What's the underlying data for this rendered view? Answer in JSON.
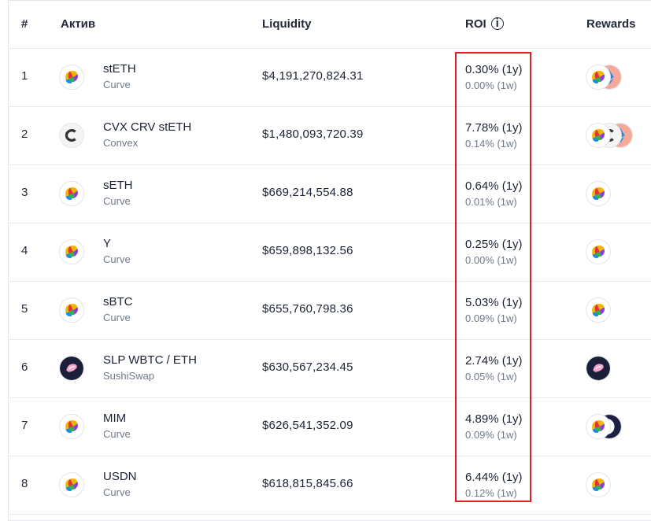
{
  "header": {
    "num": "#",
    "asset": "Актив",
    "liquidity": "Liquidity",
    "roi": "ROI",
    "roi_info_icon": "i",
    "rewards": "Rewards"
  },
  "colors": {
    "highlight": "#e11f1f",
    "muted": "#6f7a8a",
    "text": "#1a2233"
  },
  "rows": [
    {
      "num": "1",
      "name": "stETH",
      "protocol": "Curve",
      "liquidity": "$4,191,270,824.31",
      "roi_1y": "0.30% (1y)",
      "roi_1w": "0.00% (1w)",
      "icon": "curve-icon",
      "rewards": [
        "curve-icon",
        "lido-icon"
      ]
    },
    {
      "num": "2",
      "name": "CVX CRV stETH",
      "protocol": "Convex",
      "liquidity": "$1,480,093,720.39",
      "roi_1y": "7.78% (1y)",
      "roi_1w": "0.14% (1w)",
      "icon": "convex-icon",
      "rewards": [
        "curve-icon",
        "convex-icon",
        "lido-icon"
      ]
    },
    {
      "num": "3",
      "name": "sETH",
      "protocol": "Curve",
      "liquidity": "$669,214,554.88",
      "roi_1y": "0.64% (1y)",
      "roi_1w": "0.01% (1w)",
      "icon": "curve-icon",
      "rewards": [
        "curve-icon"
      ]
    },
    {
      "num": "4",
      "name": "Y",
      "protocol": "Curve",
      "liquidity": "$659,898,132.56",
      "roi_1y": "0.25% (1y)",
      "roi_1w": "0.00% (1w)",
      "icon": "curve-icon",
      "rewards": [
        "curve-icon"
      ]
    },
    {
      "num": "5",
      "name": "sBTC",
      "protocol": "Curve",
      "liquidity": "$655,760,798.36",
      "roi_1y": "5.03% (1y)",
      "roi_1w": "0.09% (1w)",
      "icon": "curve-icon",
      "rewards": [
        "curve-icon"
      ]
    },
    {
      "num": "6",
      "name": "SLP WBTC / ETH",
      "protocol": "SushiSwap",
      "liquidity": "$630,567,234.45",
      "roi_1y": "2.74% (1y)",
      "roi_1w": "0.05% (1w)",
      "icon": "sushi-icon",
      "rewards": [
        "sushi-icon"
      ]
    },
    {
      "num": "7",
      "name": "MIM",
      "protocol": "Curve",
      "liquidity": "$626,541,352.09",
      "roi_1y": "4.89% (1y)",
      "roi_1w": "0.09% (1w)",
      "icon": "curve-icon",
      "rewards": [
        "curve-icon",
        "moon-icon"
      ]
    },
    {
      "num": "8",
      "name": "USDN",
      "protocol": "Curve",
      "liquidity": "$618,815,845.66",
      "roi_1y": "6.44% (1y)",
      "roi_1w": "0.12% (1w)",
      "icon": "curve-icon",
      "rewards": [
        "curve-icon"
      ]
    }
  ]
}
